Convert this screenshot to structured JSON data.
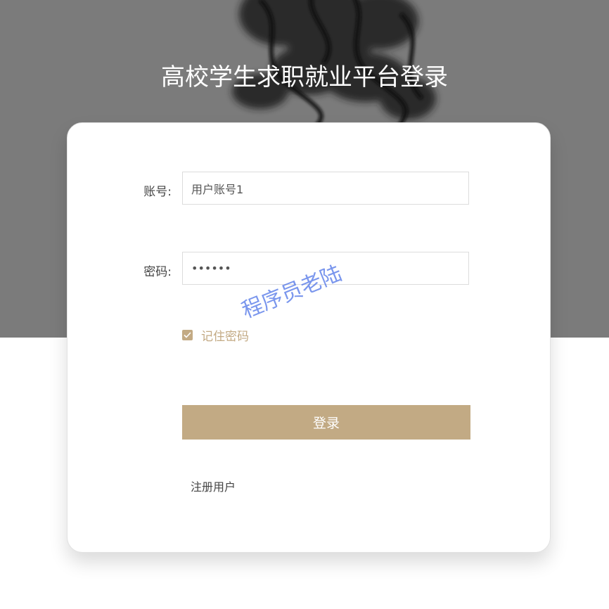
{
  "header": {
    "title": "高校学生求职就业平台登录"
  },
  "form": {
    "username_label": "账号:",
    "username_value": "用户账号1",
    "password_label": "密码:",
    "password_value": "123456",
    "remember_label": "记住密码",
    "remember_checked": true,
    "login_button": "登录",
    "register_link": "注册用户"
  },
  "watermark": {
    "text": "程序员老陆"
  },
  "colors": {
    "accent": "#c2aa84",
    "hero_background": "#7b7b7b",
    "watermark": "#466ee6"
  }
}
